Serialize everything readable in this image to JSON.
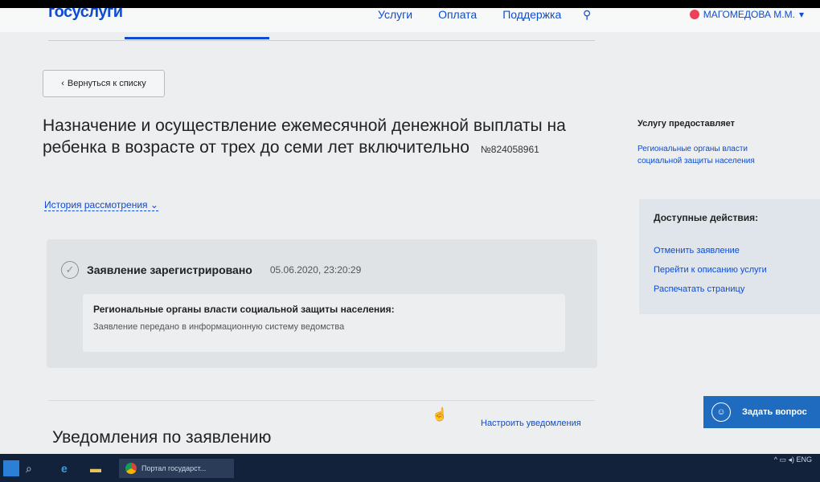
{
  "header": {
    "logo": "госуслуги",
    "nav": [
      "Услуги",
      "Оплата",
      "Поддержка"
    ],
    "user": "МАГОМЕДОВА М.М."
  },
  "back_button": "Вернуться к списку",
  "title": {
    "text": "Назначение и осуществление ежемесячной денежной выплаты на ребенка в возрасте от трех до семи лет включительно",
    "number": "№824058961"
  },
  "history_link": "История рассмотрения",
  "status": {
    "label": "Заявление зарегистрировано",
    "datetime": "05.06.2020, 23:20:29",
    "org_title": "Региональные органы власти социальной защиты населения:",
    "org_text": "Заявление передано в информационную систему ведомства"
  },
  "notifications": {
    "title": "Уведомления по заявлению",
    "settings_link": "Настроить уведомления"
  },
  "sidebar": {
    "provider_heading": "Услугу предоставляет",
    "provider_text": "Региональные органы власти социальной защиты населения",
    "actions_heading": "Доступные действия:",
    "actions": [
      "Отменить заявление",
      "Перейти к описанию услуги",
      "Распечатать страницу"
    ]
  },
  "ask_button": "Задать вопрос",
  "taskbar": {
    "chrome_tab": "Портал государст...",
    "tray": "ENG"
  },
  "colors": {
    "accent": "#0d4cd3",
    "brand_red": "#ee3f58",
    "ask_button": "#1e6bbf"
  }
}
